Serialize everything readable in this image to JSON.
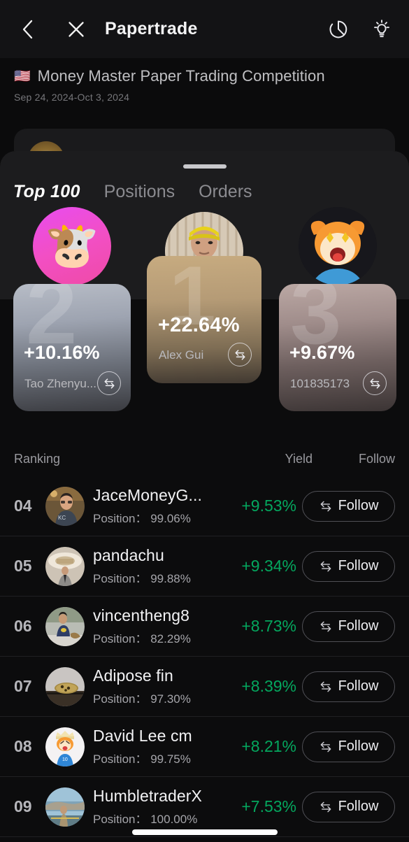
{
  "navbar": {
    "back_icon": "chevron-left-icon",
    "close_icon": "close-icon",
    "title": "Papertrade",
    "refresh_icon": "refresh-icon",
    "tips_icon": "lightbulb-icon"
  },
  "competition": {
    "flag": "🇺🇸",
    "title": "Money Master Paper Trading Competition",
    "dates": "Sep 24, 2024-Oct 3, 2024"
  },
  "sheet": {
    "grabber": "drag-handle",
    "tabs": [
      {
        "label": "Top 100",
        "active": true
      },
      {
        "label": "Positions",
        "active": false
      },
      {
        "label": "Orders",
        "active": false
      }
    ]
  },
  "podium": [
    {
      "rank": "1",
      "name": "Alex Gui",
      "yield": "+22.64%",
      "swap_icon": "swap-icon",
      "avatar": "photo-man-yellow-cap"
    },
    {
      "rank": "2",
      "name": "Tao Zhenyu...",
      "yield": "+10.16%",
      "swap_icon": "swap-icon",
      "avatar": "cartoon-bull-orange-on-pink"
    },
    {
      "rank": "3",
      "name": "101835173",
      "yield": "+9.67%",
      "swap_icon": "swap-icon",
      "avatar": "cartoon-bull-star-eyes"
    }
  ],
  "list": {
    "headers": {
      "ranking": "Ranking",
      "yield": "Yield",
      "follow": "Follow"
    },
    "follow_label": "Follow",
    "follow_icon": "swap-arrows-icon",
    "position_label": "Position：",
    "yield_color": "#04a75e",
    "rows": [
      {
        "rank": "04",
        "name": "JaceMoneyG...",
        "position": "99.06%",
        "yield": "+9.53%",
        "avatar": "photo-man-glasses-kc-shirt"
      },
      {
        "rank": "05",
        "name": "pandachu",
        "position": "99.88%",
        "yield": "+9.34%",
        "avatar": "photo-man-indoor-lobby"
      },
      {
        "rank": "06",
        "name": "vincentheng8",
        "position": "82.29%",
        "yield": "+8.73%",
        "avatar": "photo-man-sitting-outdoors"
      },
      {
        "rank": "07",
        "name": "Adipose fin",
        "position": "97.30%",
        "yield": "+8.39%",
        "avatar": "photo-fish-on-ground"
      },
      {
        "rank": "08",
        "name": "David Lee cm",
        "position": "99.75%",
        "yield": "+8.21%",
        "avatar": "cartoon-bull-crown-blue-shirt"
      },
      {
        "rank": "09",
        "name": "HumbletraderX",
        "position": "100.00%",
        "yield": "+7.53%",
        "avatar": "photo-man-coastline"
      }
    ]
  },
  "system": {
    "home_indicator": "home-indicator"
  }
}
